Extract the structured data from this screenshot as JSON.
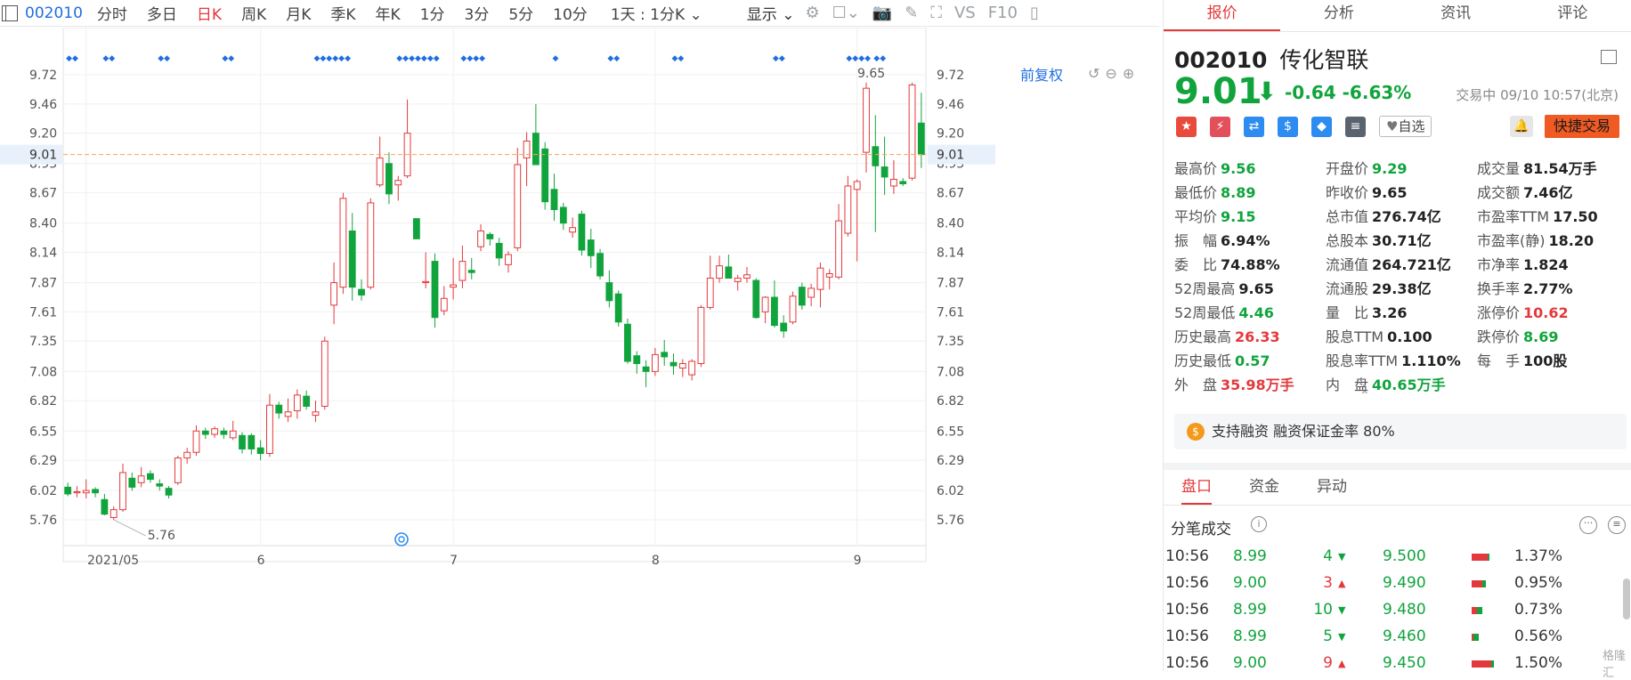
{
  "toolbar": {
    "code": "002010",
    "tabs": [
      "分时",
      "多日",
      "日K",
      "周K",
      "月K",
      "季K",
      "年K",
      "1分",
      "3分",
      "5分",
      "10分"
    ],
    "active_tab": "日K",
    "period_select": "1天 : 1分K",
    "display_select": "显示",
    "vs_label": "VS",
    "f10_label": "F10"
  },
  "chart": {
    "adjust_label": "前复权",
    "current_price_label": "9.01",
    "y_ticks": [
      "9.72",
      "9.46",
      "9.20",
      "8.93",
      "8.67",
      "8.40",
      "8.14",
      "7.87",
      "7.61",
      "7.35",
      "7.08",
      "6.82",
      "6.55",
      "6.29",
      "6.02",
      "5.76"
    ],
    "x_labels": [
      "2021/05",
      "6",
      "7",
      "8",
      "9"
    ],
    "high_annotation": "9.65",
    "low_annotation": "5.76",
    "colors": {
      "up": "#e4393c",
      "down": "#11a43d",
      "price_line": "#f5a25a",
      "marker": "#1f6fe0"
    }
  },
  "chart_data": {
    "type": "candlestick",
    "title": "",
    "xlabel": "",
    "ylabel": "",
    "ylim": [
      5.76,
      9.72
    ],
    "x_ticks": [
      "2021/05",
      "6",
      "7",
      "8",
      "9"
    ],
    "current_price": 9.01,
    "max_label": 9.65,
    "min_label": 5.76,
    "candles": [
      {
        "o": 6.05,
        "h": 6.09,
        "l": 5.97,
        "c": 5.99
      },
      {
        "o": 6.01,
        "h": 6.06,
        "l": 5.96,
        "c": 6.01
      },
      {
        "o": 6.0,
        "h": 6.12,
        "l": 5.95,
        "c": 6.02
      },
      {
        "o": 6.03,
        "h": 6.05,
        "l": 5.96,
        "c": 6.0
      },
      {
        "o": 5.94,
        "h": 5.99,
        "l": 5.8,
        "c": 5.81
      },
      {
        "o": 5.78,
        "h": 5.88,
        "l": 5.76,
        "c": 5.85
      },
      {
        "o": 5.85,
        "h": 6.26,
        "l": 5.83,
        "c": 6.18
      },
      {
        "o": 6.13,
        "h": 6.18,
        "l": 6.02,
        "c": 6.05
      },
      {
        "o": 6.09,
        "h": 6.23,
        "l": 6.05,
        "c": 6.15
      },
      {
        "o": 6.17,
        "h": 6.2,
        "l": 6.09,
        "c": 6.12
      },
      {
        "o": 6.08,
        "h": 6.12,
        "l": 6.02,
        "c": 6.06
      },
      {
        "o": 6.04,
        "h": 6.06,
        "l": 5.95,
        "c": 5.98
      },
      {
        "o": 6.09,
        "h": 6.33,
        "l": 6.07,
        "c": 6.31
      },
      {
        "o": 6.31,
        "h": 6.4,
        "l": 6.26,
        "c": 6.36
      },
      {
        "o": 6.36,
        "h": 6.6,
        "l": 6.33,
        "c": 6.55
      },
      {
        "o": 6.55,
        "h": 6.58,
        "l": 6.48,
        "c": 6.52
      },
      {
        "o": 6.52,
        "h": 6.59,
        "l": 6.49,
        "c": 6.57
      },
      {
        "o": 6.55,
        "h": 6.58,
        "l": 6.48,
        "c": 6.52
      },
      {
        "o": 6.49,
        "h": 6.64,
        "l": 6.47,
        "c": 6.55
      },
      {
        "o": 6.51,
        "h": 6.54,
        "l": 6.35,
        "c": 6.39
      },
      {
        "o": 6.51,
        "h": 6.53,
        "l": 6.34,
        "c": 6.39
      },
      {
        "o": 6.4,
        "h": 6.47,
        "l": 6.29,
        "c": 6.35
      },
      {
        "o": 6.35,
        "h": 6.88,
        "l": 6.32,
        "c": 6.78
      },
      {
        "o": 6.78,
        "h": 6.81,
        "l": 6.66,
        "c": 6.71
      },
      {
        "o": 6.68,
        "h": 6.84,
        "l": 6.63,
        "c": 6.72
      },
      {
        "o": 6.73,
        "h": 6.92,
        "l": 6.66,
        "c": 6.87
      },
      {
        "o": 6.86,
        "h": 6.91,
        "l": 6.74,
        "c": 6.77
      },
      {
        "o": 6.69,
        "h": 6.82,
        "l": 6.63,
        "c": 6.72
      },
      {
        "o": 6.77,
        "h": 7.39,
        "l": 6.74,
        "c": 7.35
      },
      {
        "o": 7.67,
        "h": 8.05,
        "l": 7.5,
        "c": 7.87
      },
      {
        "o": 7.83,
        "h": 8.67,
        "l": 7.77,
        "c": 8.62
      },
      {
        "o": 8.33,
        "h": 8.49,
        "l": 7.71,
        "c": 7.83
      },
      {
        "o": 7.81,
        "h": 7.9,
        "l": 7.71,
        "c": 7.76
      },
      {
        "o": 7.83,
        "h": 8.62,
        "l": 7.81,
        "c": 8.58
      },
      {
        "o": 8.74,
        "h": 9.17,
        "l": 8.72,
        "c": 8.98
      },
      {
        "o": 8.93,
        "h": 9.03,
        "l": 8.57,
        "c": 8.66
      },
      {
        "o": 8.74,
        "h": 8.82,
        "l": 8.6,
        "c": 8.78
      },
      {
        "o": 8.82,
        "h": 9.5,
        "l": 8.8,
        "c": 9.2
      },
      {
        "o": 8.44,
        "h": 8.44,
        "l": 8.26,
        "c": 8.26
      },
      {
        "o": 7.88,
        "h": 8.14,
        "l": 7.82,
        "c": 7.88
      },
      {
        "o": 8.06,
        "h": 8.13,
        "l": 7.47,
        "c": 7.56
      },
      {
        "o": 7.62,
        "h": 7.84,
        "l": 7.58,
        "c": 7.73
      },
      {
        "o": 7.83,
        "h": 8.09,
        "l": 7.72,
        "c": 7.85
      },
      {
        "o": 7.89,
        "h": 8.2,
        "l": 7.82,
        "c": 8.06
      },
      {
        "o": 7.98,
        "h": 8.09,
        "l": 7.9,
        "c": 7.96
      },
      {
        "o": 8.19,
        "h": 8.39,
        "l": 8.15,
        "c": 8.33
      },
      {
        "o": 8.3,
        "h": 8.32,
        "l": 8.2,
        "c": 8.26
      },
      {
        "o": 8.22,
        "h": 8.27,
        "l": 8.02,
        "c": 8.09
      },
      {
        "o": 8.03,
        "h": 8.15,
        "l": 7.96,
        "c": 8.12
      },
      {
        "o": 8.18,
        "h": 9.07,
        "l": 8.15,
        "c": 8.92
      },
      {
        "o": 8.98,
        "h": 9.21,
        "l": 8.73,
        "c": 9.13
      },
      {
        "o": 9.2,
        "h": 9.46,
        "l": 8.96,
        "c": 8.92
      },
      {
        "o": 9.06,
        "h": 9.12,
        "l": 8.52,
        "c": 8.59
      },
      {
        "o": 8.7,
        "h": 8.84,
        "l": 8.42,
        "c": 8.52
      },
      {
        "o": 8.54,
        "h": 8.58,
        "l": 8.34,
        "c": 8.4
      },
      {
        "o": 8.32,
        "h": 8.45,
        "l": 8.27,
        "c": 8.36
      },
      {
        "o": 8.48,
        "h": 8.51,
        "l": 8.11,
        "c": 8.16
      },
      {
        "o": 8.25,
        "h": 8.35,
        "l": 8.0,
        "c": 8.11
      },
      {
        "o": 8.13,
        "h": 8.17,
        "l": 7.9,
        "c": 7.93
      },
      {
        "o": 7.87,
        "h": 7.98,
        "l": 7.65,
        "c": 7.71
      },
      {
        "o": 7.77,
        "h": 7.8,
        "l": 7.48,
        "c": 7.52
      },
      {
        "o": 7.5,
        "h": 7.55,
        "l": 7.15,
        "c": 7.17
      },
      {
        "o": 7.22,
        "h": 7.26,
        "l": 7.06,
        "c": 7.15
      },
      {
        "o": 7.12,
        "h": 7.18,
        "l": 6.94,
        "c": 7.08
      },
      {
        "o": 7.08,
        "h": 7.29,
        "l": 7.04,
        "c": 7.23
      },
      {
        "o": 7.25,
        "h": 7.36,
        "l": 7.13,
        "c": 7.21
      },
      {
        "o": 7.16,
        "h": 7.24,
        "l": 7.05,
        "c": 7.13
      },
      {
        "o": 7.11,
        "h": 7.19,
        "l": 7.03,
        "c": 7.15
      },
      {
        "o": 7.05,
        "h": 7.19,
        "l": 7.0,
        "c": 7.17
      },
      {
        "o": 7.15,
        "h": 7.67,
        "l": 7.12,
        "c": 7.65
      },
      {
        "o": 7.65,
        "h": 8.11,
        "l": 7.63,
        "c": 7.91
      },
      {
        "o": 7.91,
        "h": 8.11,
        "l": 7.87,
        "c": 8.02
      },
      {
        "o": 8.01,
        "h": 8.12,
        "l": 7.91,
        "c": 7.91
      },
      {
        "o": 7.88,
        "h": 7.94,
        "l": 7.8,
        "c": 7.91
      },
      {
        "o": 7.91,
        "h": 8.01,
        "l": 7.87,
        "c": 7.94
      },
      {
        "o": 7.89,
        "h": 7.91,
        "l": 7.55,
        "c": 7.56
      },
      {
        "o": 7.61,
        "h": 7.75,
        "l": 7.51,
        "c": 7.74
      },
      {
        "o": 7.74,
        "h": 7.89,
        "l": 7.47,
        "c": 7.49
      },
      {
        "o": 7.51,
        "h": 7.58,
        "l": 7.38,
        "c": 7.44
      },
      {
        "o": 7.52,
        "h": 7.79,
        "l": 7.5,
        "c": 7.75
      },
      {
        "o": 7.83,
        "h": 7.87,
        "l": 7.63,
        "c": 7.67
      },
      {
        "o": 7.74,
        "h": 7.86,
        "l": 7.66,
        "c": 7.82
      },
      {
        "o": 7.81,
        "h": 8.05,
        "l": 7.65,
        "c": 8.0
      },
      {
        "o": 7.92,
        "h": 7.99,
        "l": 7.81,
        "c": 7.95
      },
      {
        "o": 7.92,
        "h": 8.57,
        "l": 7.9,
        "c": 8.42
      },
      {
        "o": 8.31,
        "h": 8.82,
        "l": 8.28,
        "c": 8.73
      },
      {
        "o": 8.7,
        "h": 8.79,
        "l": 8.06,
        "c": 8.77
      },
      {
        "o": 9.03,
        "h": 9.65,
        "l": 8.85,
        "c": 9.6
      },
      {
        "o": 9.08,
        "h": 9.36,
        "l": 8.32,
        "c": 8.91
      },
      {
        "o": 8.9,
        "h": 9.17,
        "l": 8.65,
        "c": 8.81
      },
      {
        "o": 8.73,
        "h": 8.96,
        "l": 8.66,
        "c": 8.79
      },
      {
        "o": 8.77,
        "h": 8.8,
        "l": 8.73,
        "c": 8.75
      },
      {
        "o": 8.8,
        "h": 9.65,
        "l": 8.78,
        "c": 9.63
      },
      {
        "o": 9.29,
        "h": 9.56,
        "l": 8.89,
        "c": 9.01
      }
    ],
    "event_markers": [
      {
        "label": "◆◆",
        "at": 0
      },
      {
        "label": "◆◆",
        "at": 4
      },
      {
        "label": "◆◆",
        "at": 10
      },
      {
        "label": "◆◆",
        "at": 17
      },
      {
        "label": "◆◆◆◆◆◆",
        "at": 27
      },
      {
        "label": "◆◆◆◆◆◆◆",
        "at": 36
      },
      {
        "label": "◆◆◆◆",
        "at": 43
      },
      {
        "label": "◆",
        "at": 53
      },
      {
        "label": "◆◆",
        "at": 59
      },
      {
        "label": "◆◆",
        "at": 66
      },
      {
        "label": "◆◆",
        "at": 77
      },
      {
        "label": "◆◆◆◆",
        "at": 85
      },
      {
        "label": "◆◆",
        "at": 88
      }
    ]
  },
  "right_panel": {
    "tabs": [
      "报价",
      "分析",
      "资讯",
      "评论"
    ],
    "active_tab": "报价",
    "stock_code": "002010",
    "stock_name": "传化智联",
    "price": "9.01",
    "change": "-0.64",
    "change_pct": "-6.63%",
    "status": "交易中 09/10 10:57(北京)",
    "watch_label": "自选",
    "trade_label": "快捷交易",
    "quote_rows": [
      [
        {
          "l": "最高价",
          "v": "9.56",
          "c": "dn"
        },
        {
          "l": "开盘价",
          "v": "9.29",
          "c": "dn"
        },
        {
          "l": "成交量",
          "v": "81.54万手",
          "c": ""
        }
      ],
      [
        {
          "l": "最低价",
          "v": "8.89",
          "c": "dn"
        },
        {
          "l": "昨收价",
          "v": "9.65",
          "c": ""
        },
        {
          "l": "成交额",
          "v": "7.46亿",
          "c": ""
        }
      ],
      [
        {
          "l": "平均价",
          "v": "9.15",
          "c": "dn"
        },
        {
          "l": "总市值",
          "v": "276.74亿",
          "c": ""
        },
        {
          "l": "市盈率TTM",
          "v": "17.50",
          "c": ""
        }
      ],
      [
        {
          "l": "振　幅",
          "v": "6.94%",
          "c": ""
        },
        {
          "l": "总股本",
          "v": "30.71亿",
          "c": ""
        },
        {
          "l": "市盈率(静)",
          "v": "18.20",
          "c": ""
        }
      ],
      [
        {
          "l": "委　比",
          "v": "74.88%",
          "c": ""
        },
        {
          "l": "流通值",
          "v": "264.721亿",
          "c": ""
        },
        {
          "l": "市净率",
          "v": "1.824",
          "c": ""
        }
      ],
      [
        {
          "l": "52周最高",
          "v": "9.65",
          "c": ""
        },
        {
          "l": "流通股",
          "v": "29.38亿",
          "c": ""
        },
        {
          "l": "换手率",
          "v": "2.77%",
          "c": ""
        }
      ],
      [
        {
          "l": "52周最低",
          "v": "4.46",
          "c": "dn"
        },
        {
          "l": "量　比",
          "v": "3.26",
          "c": ""
        },
        {
          "l": "涨停价",
          "v": "10.62",
          "c": "up"
        }
      ],
      [
        {
          "l": "历史最高",
          "v": "26.33",
          "c": "up"
        },
        {
          "l": "股息TTM",
          "v": "0.100",
          "c": ""
        },
        {
          "l": "跌停价",
          "v": "8.69",
          "c": "dn"
        }
      ],
      [
        {
          "l": "历史最低",
          "v": "0.57",
          "c": "dn"
        },
        {
          "l": "股息率TTM",
          "v": "1.110%",
          "c": ""
        },
        {
          "l": "每　手",
          "v": "100股",
          "c": ""
        }
      ],
      [
        {
          "l": "外　盘",
          "v": "35.98万手",
          "c": "up"
        },
        {
          "l": "内　盘",
          "v": "40.65万手",
          "c": "dn"
        },
        {
          "l": "",
          "v": "",
          "c": ""
        }
      ]
    ],
    "margin_text": "支持融资 融资保证金率 80%",
    "bottom_tabs": [
      "盘口",
      "资金",
      "异动"
    ],
    "active_bottom_tab": "盘口",
    "ticks_title": "分笔成交",
    "trades": [
      {
        "time": "10:56",
        "price": "8.99",
        "vol": "4",
        "dir": "down",
        "lvl": "9.500",
        "pct": "1.37%"
      },
      {
        "time": "10:56",
        "price": "9.00",
        "vol": "3",
        "dir": "up",
        "lvl": "9.490",
        "pct": "0.95%"
      },
      {
        "time": "10:56",
        "price": "8.99",
        "vol": "10",
        "dir": "down",
        "lvl": "9.480",
        "pct": "0.73%"
      },
      {
        "time": "10:56",
        "price": "8.99",
        "vol": "5",
        "dir": "down",
        "lvl": "9.460",
        "pct": "0.56%"
      },
      {
        "time": "10:56",
        "price": "9.00",
        "vol": "9",
        "dir": "up",
        "lvl": "9.450",
        "pct": "1.50%"
      }
    ],
    "watermark": "格隆汇"
  }
}
